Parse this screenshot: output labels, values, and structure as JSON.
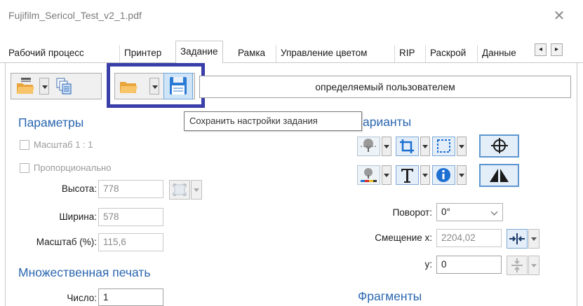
{
  "window": {
    "title": "Fujifilm_Sericol_Test_v2_1.pdf",
    "close_glyph": "✕"
  },
  "tabs": [
    {
      "label": "Рабочий процесс",
      "active": false
    },
    {
      "label": "Принтер",
      "active": false
    },
    {
      "label": "Задание",
      "active": true
    },
    {
      "label": "Рамка",
      "active": false
    },
    {
      "label": "Управление цветом",
      "active": false
    },
    {
      "label": "RIP",
      "active": false
    },
    {
      "label": "Раскрой",
      "active": false
    },
    {
      "label": "Данные",
      "active": false
    }
  ],
  "tab_scroll": {
    "left": "◂",
    "right": "▸"
  },
  "toolbar": {
    "icons": [
      "open-folder-icon",
      "copy-pages-icon",
      "open-folder-icon",
      "save-disk-icon"
    ],
    "job_name_value": "определяемый пользователем",
    "tooltip": "Сохранить настройки задания",
    "highlight_color": "#3a3ea8"
  },
  "params": {
    "heading": "Параметры",
    "scale_checkbox": "Масштаб 1 : 1",
    "proportional_checkbox": "Пропорционально",
    "height_label": "Высота:",
    "height_value": "778",
    "width_label": "Ширина:",
    "width_value": "578",
    "scale_label": "Масштаб (%):",
    "scale_value": "115,6"
  },
  "multiprint": {
    "heading": "Множественная печать",
    "count_label": "Число:",
    "count_value": "1"
  },
  "variants": {
    "heading": "Варианты",
    "heading_visible": "арианты",
    "rotation_label": "Поворот:",
    "rotation_value": "0°",
    "offset_x_label": "Смещение x:",
    "offset_x_value": "2204,02",
    "offset_y_label": "y:",
    "offset_y_value": "0"
  },
  "fragments": {
    "heading": "Фрагменты"
  },
  "colors": {
    "accent": "#2a66b0",
    "icon_blue": "#1d6fd1",
    "folder": "#f0a830"
  }
}
